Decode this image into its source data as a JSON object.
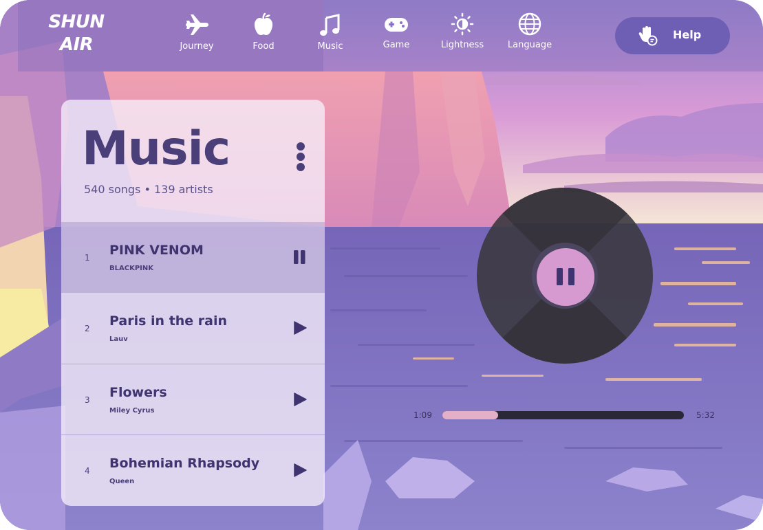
{
  "brand": {
    "line1": "SHUN",
    "line2": "AIR"
  },
  "nav": [
    {
      "label": "Journey",
      "icon": "airplane-icon"
    },
    {
      "label": "Food",
      "icon": "apple-icon"
    },
    {
      "label": "Music",
      "icon": "music-note-icon"
    },
    {
      "label": "Game",
      "icon": "gamepad-icon"
    },
    {
      "label": "Lightness",
      "icon": "brightness-icon"
    },
    {
      "label": "Language",
      "icon": "globe-icon"
    }
  ],
  "help": {
    "label": "Help",
    "icon": "raised-hand-icon"
  },
  "music_panel": {
    "title": "Music",
    "subtitle": "540 songs • 139 artists",
    "tracks": [
      {
        "number": "1",
        "title": "PINK VENOM",
        "artist": "BLACKPINK",
        "state": "playing"
      },
      {
        "number": "2",
        "title": "Paris in the rain",
        "artist": "Lauv",
        "state": "paused"
      },
      {
        "number": "3",
        "title": "Flowers",
        "artist": "Miley Cyrus",
        "state": "paused"
      },
      {
        "number": "4",
        "title": "Bohemian Rhapsody",
        "artist": "Queen",
        "state": "paused"
      }
    ]
  },
  "player": {
    "elapsed": "1:09",
    "total": "5:32",
    "progress_fraction": 0.23
  },
  "colors": {
    "accent": "#4a3f78",
    "help_button": "#6f5fb4",
    "progress_fill": "#e4b0c8",
    "progress_track": "#2a2736",
    "vinyl_label": "#d79ad0"
  }
}
